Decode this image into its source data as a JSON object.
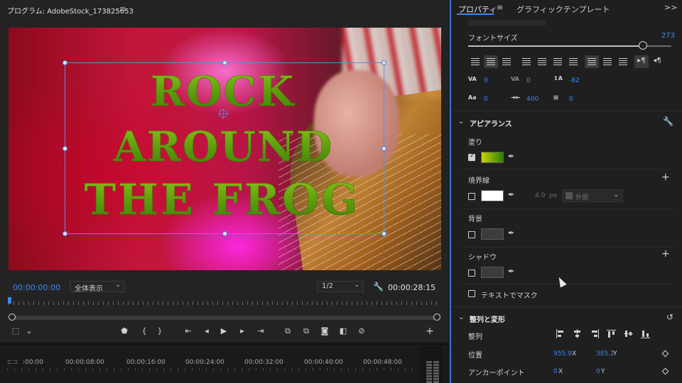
{
  "monitor": {
    "title": "プログラム: AdobeStock_173825653",
    "menu_icon": "hamburger-menu-icon",
    "title_text": {
      "line1": "ROCK",
      "line2": "AROUND",
      "line3": "THE FROG"
    },
    "timecode_current": "00:00:00:00",
    "zoom": "全体表示",
    "resolution": "1/2",
    "timecode_duration": "00:00:28:15",
    "playhead_color": "#3f86ec"
  },
  "transport": {
    "buttons": [
      "add-marker-icon",
      "mark-in-icon",
      "mark-out-icon",
      "go-to-in-icon",
      "step-back-icon",
      "play-icon",
      "step-forward-icon",
      "go-to-out-icon",
      "lift-icon",
      "extract-icon",
      "export-frame-icon",
      "comparison-view-icon",
      "proxy-toggle-icon",
      "button-editor-plus-icon"
    ]
  },
  "timeline": {
    "ticks": [
      ":00:00",
      "00:00:08:00",
      "00:00:16:00",
      "00:00:24:00",
      "00:00:32:00",
      "00:00:40:00",
      "00:00:48:00"
    ]
  },
  "panel": {
    "tabs": {
      "properties": "プロパティ",
      "graphics_templates": "グラフィックテンプレート",
      "more": ">>"
    },
    "font_size": {
      "label": "フォントサイズ",
      "value": "273",
      "fraction": 0.86
    },
    "metrics": {
      "tracking_label": "VA",
      "tracking": "0",
      "kerning_label": "VA",
      "kerning": "0",
      "leading": "-82",
      "baseline_label": "Aa",
      "baseline": "0",
      "tsume": "400",
      "tab_value": "0"
    },
    "appearance": {
      "title": "アピアランス",
      "fill": {
        "label": "塗り",
        "checked": true,
        "color_start": "#c8d400",
        "color_end": "#2f7d00"
      },
      "stroke": {
        "label": "境界線",
        "checked": false,
        "color": "#ffffff",
        "width": "4.0",
        "unit": "px",
        "position": "外側"
      },
      "background": {
        "label": "背景",
        "checked": false,
        "color": "#3c3c3c"
      },
      "shadow": {
        "label": "シャドウ",
        "checked": false,
        "color": "#3c3c3c"
      },
      "mask": {
        "label": "テキストでマスク",
        "checked": false
      }
    },
    "align_transform": {
      "title": "整列と変形",
      "align_label": "整列",
      "position_label": "位置",
      "position_x": "955.9",
      "position_y": "385.2",
      "anchor_label": "アンカーポイント",
      "anchor_x": "0",
      "anchor_y": "0",
      "x_label": "X",
      "y_label": "Y"
    },
    "accent_color": "#3f86ec"
  }
}
